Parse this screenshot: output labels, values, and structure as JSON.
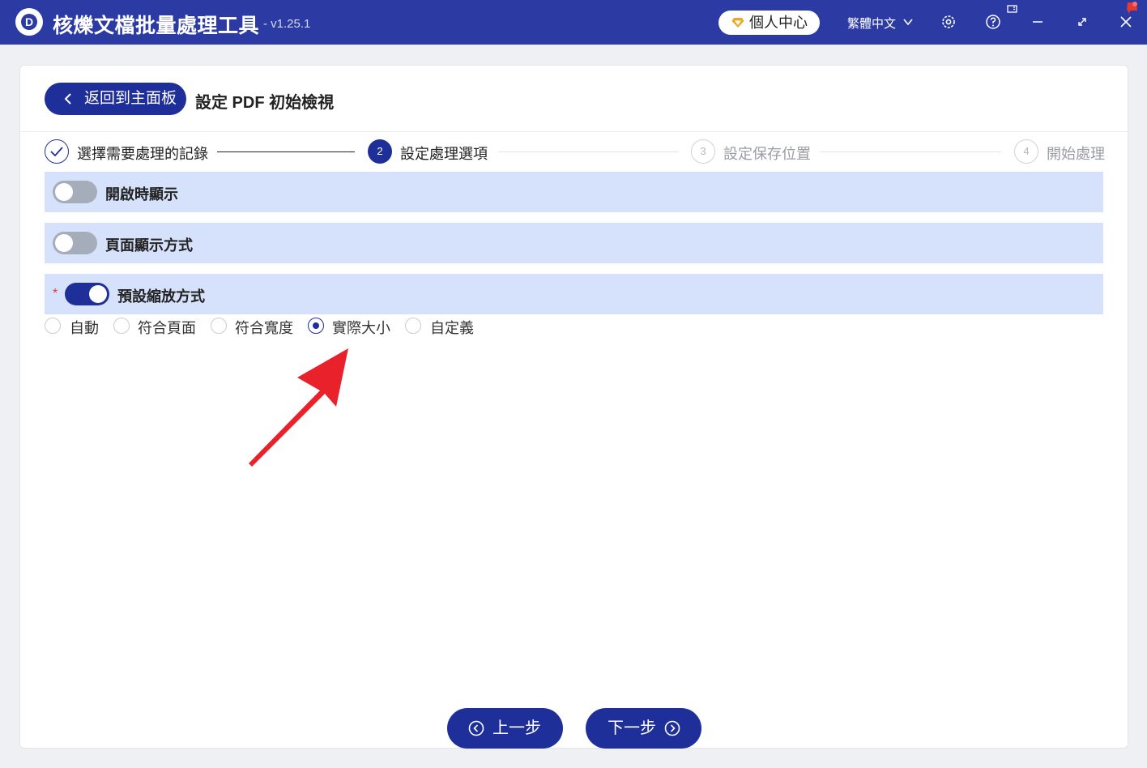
{
  "app": {
    "title": "核爍文檔批量處理工具",
    "version": "- v1.25.1",
    "personal_center": "個人中心",
    "language": "繁體中文"
  },
  "toolbar": {
    "back_label": "返回到主面板",
    "page_title": "設定 PDF 初始檢視"
  },
  "steps": [
    {
      "number": "",
      "label": "選擇需要處理的記錄",
      "state": "done"
    },
    {
      "number": "2",
      "label": "設定處理選項",
      "state": "active"
    },
    {
      "number": "3",
      "label": "設定保存位置",
      "state": "pending"
    },
    {
      "number": "4",
      "label": "開始處理",
      "state": "pending"
    }
  ],
  "sections": [
    {
      "label": "開啟時顯示",
      "enabled": false
    },
    {
      "label": "頁面顯示方式",
      "enabled": false
    },
    {
      "label": "預設縮放方式",
      "enabled": true,
      "required_mark": "*"
    }
  ],
  "zoom_options": [
    {
      "label": "自動",
      "selected": false
    },
    {
      "label": "符合頁面",
      "selected": false
    },
    {
      "label": "符合寬度",
      "selected": false
    },
    {
      "label": "實際大小",
      "selected": true
    },
    {
      "label": "自定義",
      "selected": false
    }
  ],
  "footer": {
    "prev_label": "上一步",
    "next_label": "下一步"
  },
  "colors": {
    "titlebar": "#2b3ba3",
    "primary": "#1f2f9a",
    "section_bg": "#d6e2fb",
    "annotation_arrow": "#e8212a"
  }
}
